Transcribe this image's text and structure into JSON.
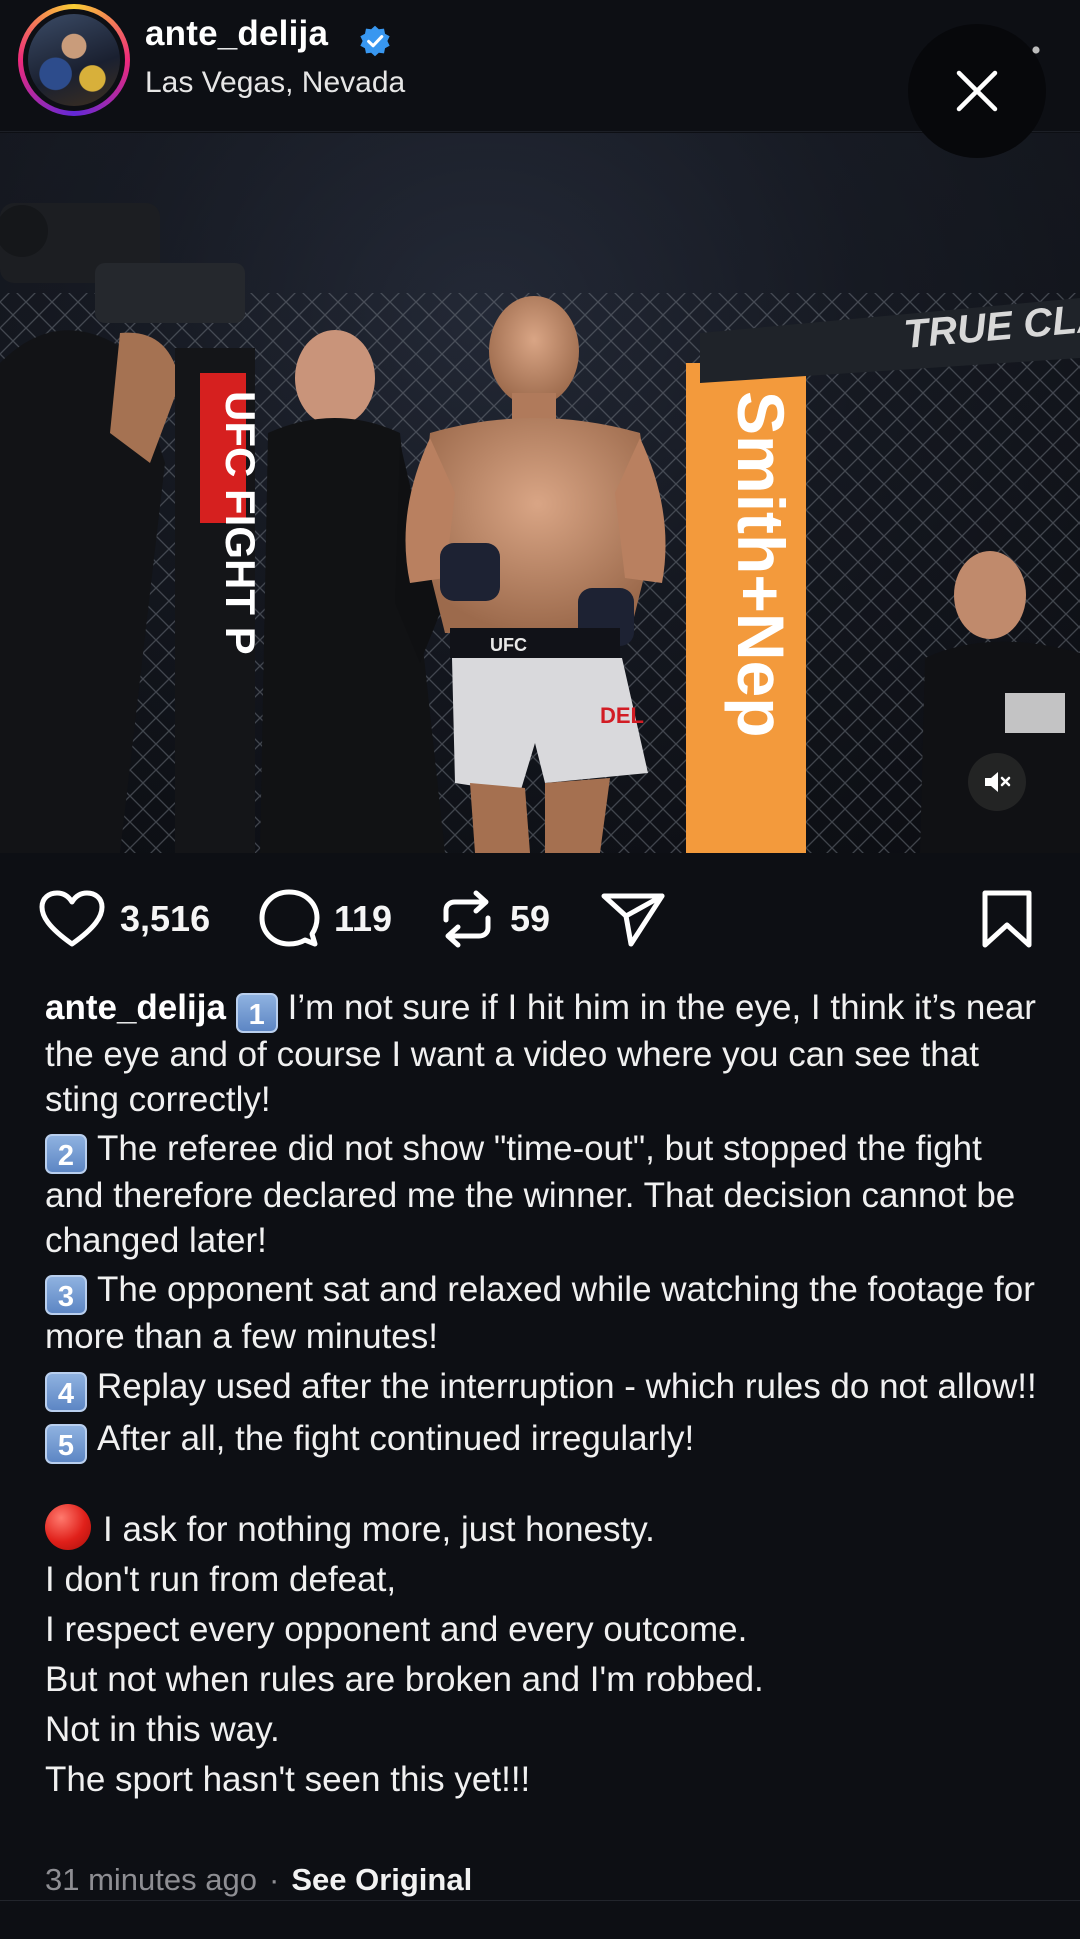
{
  "header": {
    "username": "ante_delija",
    "verified": true,
    "location": "Las Vegas, Nevada"
  },
  "media": {
    "cage_pad_left": "UFC FIGHT P",
    "cage_pad_right": "Smith+Nep",
    "cage_banner": "TRUE CLAS",
    "shorts_brand": "UFC",
    "shorts_name": "DEL"
  },
  "actions": {
    "likes": "3,516",
    "comments": "119",
    "reposts": "59"
  },
  "caption": {
    "username": "ante_delija",
    "items": [
      {
        "num": "1",
        "text": "I’m not sure if I hit him in the eye, I think it’s near the eye and of course I want a video where you can see that sting correctly!"
      },
      {
        "num": "2",
        "text": "The referee did not show \"time-out\", but stopped the fight and therefore declared me the winner. That decision cannot be changed later!"
      },
      {
        "num": "3",
        "text": "The opponent sat and relaxed while watching the footage for more than a few minutes!"
      },
      {
        "num": "4",
        "text": "Replay used after the interruption - which rules do not allow!!"
      },
      {
        "num": "5",
        "text": "After all, the fight continued irregularly!"
      }
    ],
    "lines": [
      "I ask for nothing more, just honesty.",
      "I don't run from defeat,",
      "I respect every opponent and every outcome.",
      "But not when rules are broken and I'm robbed.",
      "Not in this way.",
      "The sport hasn't seen this yet!!!"
    ]
  },
  "meta": {
    "timestamp": "31 minutes ago",
    "separator": "·",
    "see_original": "See Original"
  },
  "colors": {
    "background": "#0d0f14",
    "verified_blue": "#3897f0",
    "keycap_blue": "#6b93cf",
    "red_dot": "#e0201a"
  },
  "icons": [
    "verified-icon",
    "more-icon",
    "close-icon",
    "mute-icon",
    "heart-icon",
    "comment-icon",
    "repost-icon",
    "share-icon",
    "bookmark-icon",
    "red-circle-emoji"
  ]
}
